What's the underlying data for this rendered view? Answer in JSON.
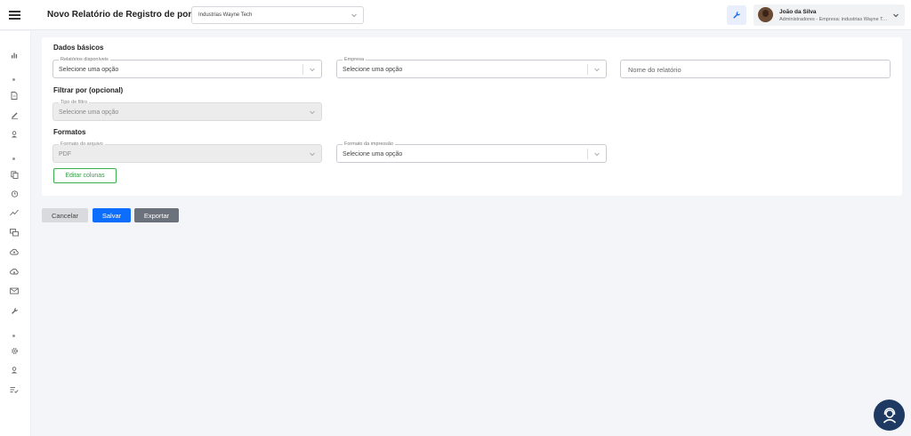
{
  "header": {
    "title": "Novo Relatório de Registro de ponto",
    "company_select": "Industrias Wayne Tech",
    "user": {
      "name": "João da Silva",
      "role": "Administradores - Empresa: industrias Wayne Tech"
    }
  },
  "sidebar": {
    "icons": [
      "bar-chart-icon",
      "document-icon",
      "pen-icon",
      "user-icon",
      "copy-icon",
      "alarm-clock-icon",
      "trend-line-icon",
      "chat-icon",
      "cloud-upload-icon",
      "cloud-download-icon",
      "mail-icon",
      "wrench-icon",
      "gear-icon",
      "user-icon",
      "checklist-icon"
    ]
  },
  "form": {
    "basic_title": "Dados básicos",
    "report_label": "Relatórios disponíveis",
    "report_value": "Selecione uma opção",
    "company_label": "Empresa",
    "company_value": "Selecione uma opção",
    "name_placeholder": "Nome do relatório",
    "filter_title": "Filtrar por (opcional)",
    "filter_label": "Tipo de filtro",
    "filter_value": "Selecione uma opção",
    "formats_title": "Formatos",
    "file_format_label": "Formato do arquivo",
    "file_format_value": "PDF",
    "print_format_label": "Formato da impressão",
    "print_format_value": "Selecione uma opção",
    "edit_columns": "Editar colunas"
  },
  "actions": {
    "cancel": "Cancelar",
    "save": "Salvar",
    "export": "Exportar"
  },
  "colors": {
    "primary": "#0d6efd",
    "success": "#37b24d",
    "secondary": "#6c727b",
    "fab": "#1e3a63"
  }
}
